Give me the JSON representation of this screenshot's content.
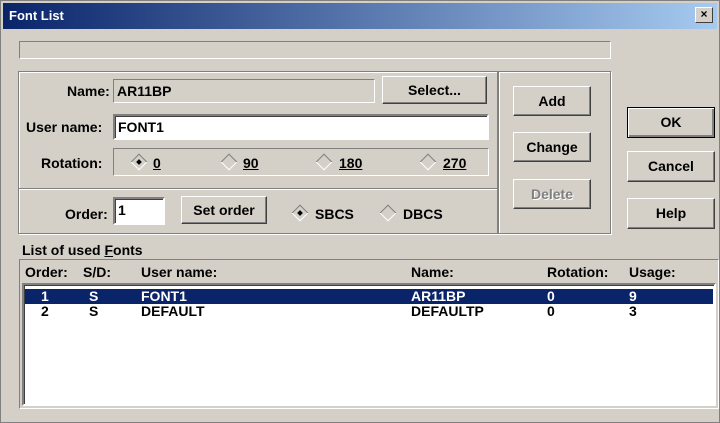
{
  "window": {
    "title": "Font List",
    "close_label": "×"
  },
  "name": {
    "label": "Name:",
    "value": "AR11BP"
  },
  "user_name": {
    "label": "User name:",
    "value": "FONT1"
  },
  "rotation": {
    "label": "Rotation:",
    "options": [
      {
        "label": "0",
        "checked": true
      },
      {
        "label": "90",
        "checked": false
      },
      {
        "label": "180",
        "checked": false
      },
      {
        "label": "270",
        "checked": false
      }
    ]
  },
  "order": {
    "label": "Order:",
    "value": "1"
  },
  "charset": {
    "options": [
      {
        "label": "SBCS",
        "checked": true
      },
      {
        "label": "DBCS",
        "checked": false
      }
    ]
  },
  "buttons": {
    "select": "Select...",
    "set_order": "Set order",
    "add": "Add",
    "change": "Change",
    "delete": "Delete",
    "ok": "OK",
    "cancel": "Cancel",
    "help": "Help"
  },
  "fonts_list": {
    "title_prefix": "List of used ",
    "title_underlined": "F",
    "title_suffix": "onts",
    "columns": [
      "Order:",
      "S/D:",
      "User name:",
      "Name:",
      "Rotation:",
      "Usage:"
    ],
    "rows": [
      {
        "order": "1",
        "sd": "S",
        "user_name": "FONT1",
        "name": "AR11BP",
        "rotation": "0",
        "usage": "9",
        "selected": true
      },
      {
        "order": "2",
        "sd": "S",
        "user_name": "DEFAULT",
        "name": "DEFAULTP",
        "rotation": "0",
        "usage": "3",
        "selected": false
      }
    ]
  }
}
